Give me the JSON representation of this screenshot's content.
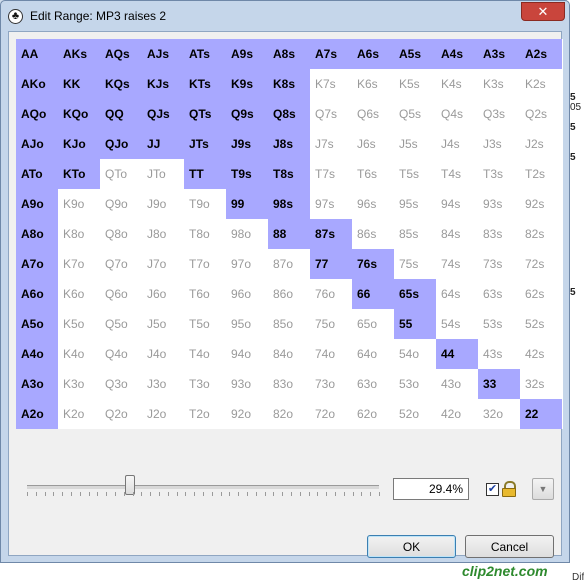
{
  "window": {
    "title": "Edit Range: MP3 raises 2",
    "close_glyph": "✕",
    "app_icon": "club-suit-icon"
  },
  "range_grid": {
    "selected_color": "#a8a8ff",
    "unselected_text_color": "#9a9a9a",
    "rows": [
      [
        {
          "label": "AA",
          "selected": true
        },
        {
          "label": "AKs",
          "selected": true
        },
        {
          "label": "AQs",
          "selected": true
        },
        {
          "label": "AJs",
          "selected": true
        },
        {
          "label": "ATs",
          "selected": true
        },
        {
          "label": "A9s",
          "selected": true
        },
        {
          "label": "A8s",
          "selected": true
        },
        {
          "label": "A7s",
          "selected": true
        },
        {
          "label": "A6s",
          "selected": true
        },
        {
          "label": "A5s",
          "selected": true
        },
        {
          "label": "A4s",
          "selected": true
        },
        {
          "label": "A3s",
          "selected": true
        },
        {
          "label": "A2s",
          "selected": true
        }
      ],
      [
        {
          "label": "AKo",
          "selected": true
        },
        {
          "label": "KK",
          "selected": true
        },
        {
          "label": "KQs",
          "selected": true
        },
        {
          "label": "KJs",
          "selected": true
        },
        {
          "label": "KTs",
          "selected": true
        },
        {
          "label": "K9s",
          "selected": true
        },
        {
          "label": "K8s",
          "selected": true
        },
        {
          "label": "K7s",
          "selected": false
        },
        {
          "label": "K6s",
          "selected": false
        },
        {
          "label": "K5s",
          "selected": false
        },
        {
          "label": "K4s",
          "selected": false
        },
        {
          "label": "K3s",
          "selected": false
        },
        {
          "label": "K2s",
          "selected": false
        }
      ],
      [
        {
          "label": "AQo",
          "selected": true
        },
        {
          "label": "KQo",
          "selected": true
        },
        {
          "label": "QQ",
          "selected": true
        },
        {
          "label": "QJs",
          "selected": true
        },
        {
          "label": "QTs",
          "selected": true
        },
        {
          "label": "Q9s",
          "selected": true
        },
        {
          "label": "Q8s",
          "selected": true
        },
        {
          "label": "Q7s",
          "selected": false
        },
        {
          "label": "Q6s",
          "selected": false
        },
        {
          "label": "Q5s",
          "selected": false
        },
        {
          "label": "Q4s",
          "selected": false
        },
        {
          "label": "Q3s",
          "selected": false
        },
        {
          "label": "Q2s",
          "selected": false
        }
      ],
      [
        {
          "label": "AJo",
          "selected": true
        },
        {
          "label": "KJo",
          "selected": true
        },
        {
          "label": "QJo",
          "selected": true
        },
        {
          "label": "JJ",
          "selected": true
        },
        {
          "label": "JTs",
          "selected": true
        },
        {
          "label": "J9s",
          "selected": true
        },
        {
          "label": "J8s",
          "selected": true
        },
        {
          "label": "J7s",
          "selected": false
        },
        {
          "label": "J6s",
          "selected": false
        },
        {
          "label": "J5s",
          "selected": false
        },
        {
          "label": "J4s",
          "selected": false
        },
        {
          "label": "J3s",
          "selected": false
        },
        {
          "label": "J2s",
          "selected": false
        }
      ],
      [
        {
          "label": "ATo",
          "selected": true
        },
        {
          "label": "KTo",
          "selected": true
        },
        {
          "label": "QTo",
          "selected": false
        },
        {
          "label": "JTo",
          "selected": false
        },
        {
          "label": "TT",
          "selected": true
        },
        {
          "label": "T9s",
          "selected": true
        },
        {
          "label": "T8s",
          "selected": true
        },
        {
          "label": "T7s",
          "selected": false
        },
        {
          "label": "T6s",
          "selected": false
        },
        {
          "label": "T5s",
          "selected": false
        },
        {
          "label": "T4s",
          "selected": false
        },
        {
          "label": "T3s",
          "selected": false
        },
        {
          "label": "T2s",
          "selected": false
        }
      ],
      [
        {
          "label": "A9o",
          "selected": true
        },
        {
          "label": "K9o",
          "selected": false
        },
        {
          "label": "Q9o",
          "selected": false
        },
        {
          "label": "J9o",
          "selected": false
        },
        {
          "label": "T9o",
          "selected": false
        },
        {
          "label": "99",
          "selected": true
        },
        {
          "label": "98s",
          "selected": true
        },
        {
          "label": "97s",
          "selected": false
        },
        {
          "label": "96s",
          "selected": false
        },
        {
          "label": "95s",
          "selected": false
        },
        {
          "label": "94s",
          "selected": false
        },
        {
          "label": "93s",
          "selected": false
        },
        {
          "label": "92s",
          "selected": false
        }
      ],
      [
        {
          "label": "A8o",
          "selected": true
        },
        {
          "label": "K8o",
          "selected": false
        },
        {
          "label": "Q8o",
          "selected": false
        },
        {
          "label": "J8o",
          "selected": false
        },
        {
          "label": "T8o",
          "selected": false
        },
        {
          "label": "98o",
          "selected": false
        },
        {
          "label": "88",
          "selected": true
        },
        {
          "label": "87s",
          "selected": true
        },
        {
          "label": "86s",
          "selected": false
        },
        {
          "label": "85s",
          "selected": false
        },
        {
          "label": "84s",
          "selected": false
        },
        {
          "label": "83s",
          "selected": false
        },
        {
          "label": "82s",
          "selected": false
        }
      ],
      [
        {
          "label": "A7o",
          "selected": true
        },
        {
          "label": "K7o",
          "selected": false
        },
        {
          "label": "Q7o",
          "selected": false
        },
        {
          "label": "J7o",
          "selected": false
        },
        {
          "label": "T7o",
          "selected": false
        },
        {
          "label": "97o",
          "selected": false
        },
        {
          "label": "87o",
          "selected": false
        },
        {
          "label": "77",
          "selected": true
        },
        {
          "label": "76s",
          "selected": true
        },
        {
          "label": "75s",
          "selected": false
        },
        {
          "label": "74s",
          "selected": false
        },
        {
          "label": "73s",
          "selected": false
        },
        {
          "label": "72s",
          "selected": false
        }
      ],
      [
        {
          "label": "A6o",
          "selected": true
        },
        {
          "label": "K6o",
          "selected": false
        },
        {
          "label": "Q6o",
          "selected": false
        },
        {
          "label": "J6o",
          "selected": false
        },
        {
          "label": "T6o",
          "selected": false
        },
        {
          "label": "96o",
          "selected": false
        },
        {
          "label": "86o",
          "selected": false
        },
        {
          "label": "76o",
          "selected": false
        },
        {
          "label": "66",
          "selected": true
        },
        {
          "label": "65s",
          "selected": true
        },
        {
          "label": "64s",
          "selected": false
        },
        {
          "label": "63s",
          "selected": false
        },
        {
          "label": "62s",
          "selected": false
        }
      ],
      [
        {
          "label": "A5o",
          "selected": true
        },
        {
          "label": "K5o",
          "selected": false
        },
        {
          "label": "Q5o",
          "selected": false
        },
        {
          "label": "J5o",
          "selected": false
        },
        {
          "label": "T5o",
          "selected": false
        },
        {
          "label": "95o",
          "selected": false
        },
        {
          "label": "85o",
          "selected": false
        },
        {
          "label": "75o",
          "selected": false
        },
        {
          "label": "65o",
          "selected": false
        },
        {
          "label": "55",
          "selected": true
        },
        {
          "label": "54s",
          "selected": false
        },
        {
          "label": "53s",
          "selected": false
        },
        {
          "label": "52s",
          "selected": false
        }
      ],
      [
        {
          "label": "A4o",
          "selected": true
        },
        {
          "label": "K4o",
          "selected": false
        },
        {
          "label": "Q4o",
          "selected": false
        },
        {
          "label": "J4o",
          "selected": false
        },
        {
          "label": "T4o",
          "selected": false
        },
        {
          "label": "94o",
          "selected": false
        },
        {
          "label": "84o",
          "selected": false
        },
        {
          "label": "74o",
          "selected": false
        },
        {
          "label": "64o",
          "selected": false
        },
        {
          "label": "54o",
          "selected": false
        },
        {
          "label": "44",
          "selected": true
        },
        {
          "label": "43s",
          "selected": false
        },
        {
          "label": "42s",
          "selected": false
        }
      ],
      [
        {
          "label": "A3o",
          "selected": true
        },
        {
          "label": "K3o",
          "selected": false
        },
        {
          "label": "Q3o",
          "selected": false
        },
        {
          "label": "J3o",
          "selected": false
        },
        {
          "label": "T3o",
          "selected": false
        },
        {
          "label": "93o",
          "selected": false
        },
        {
          "label": "83o",
          "selected": false
        },
        {
          "label": "73o",
          "selected": false
        },
        {
          "label": "63o",
          "selected": false
        },
        {
          "label": "53o",
          "selected": false
        },
        {
          "label": "43o",
          "selected": false
        },
        {
          "label": "33",
          "selected": true
        },
        {
          "label": "32s",
          "selected": false
        }
      ],
      [
        {
          "label": "A2o",
          "selected": true
        },
        {
          "label": "K2o",
          "selected": false
        },
        {
          "label": "Q2o",
          "selected": false
        },
        {
          "label": "J2o",
          "selected": false
        },
        {
          "label": "T2o",
          "selected": false
        },
        {
          "label": "92o",
          "selected": false
        },
        {
          "label": "82o",
          "selected": false
        },
        {
          "label": "72o",
          "selected": false
        },
        {
          "label": "62o",
          "selected": false
        },
        {
          "label": "52o",
          "selected": false
        },
        {
          "label": "42o",
          "selected": false
        },
        {
          "label": "32o",
          "selected": false
        },
        {
          "label": "22",
          "selected": true
        }
      ]
    ]
  },
  "controls": {
    "range_percent": "29.4%",
    "slider_fraction": 0.294,
    "lock_checked": true,
    "lock_check_glyph": "✔",
    "lock_icon": "padlock-icon",
    "dropdown_glyph": "▼"
  },
  "buttons": {
    "ok": "OK",
    "cancel": "Cancel"
  },
  "background_fragments": {
    "right": [
      "5",
      "05",
      "5",
      "5",
      "5"
    ],
    "bottom": "Dif"
  },
  "watermark": "clip2net.com"
}
